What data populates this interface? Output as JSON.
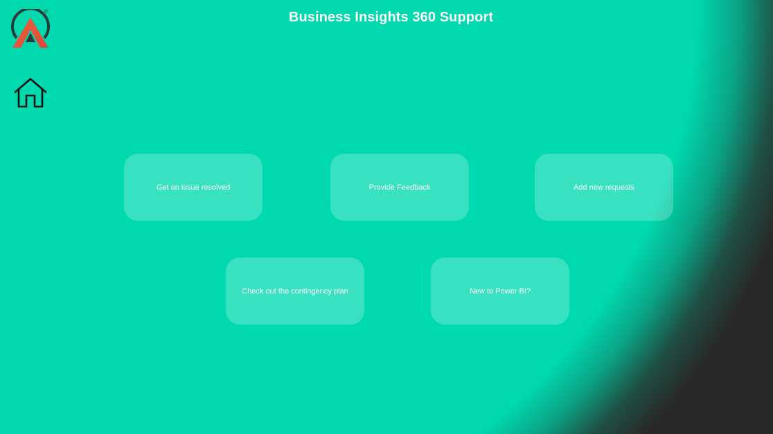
{
  "header": {
    "title": "Business Insights 360 Support",
    "registered_mark": "®"
  },
  "nav": {
    "logo_icon": "brand-logo-icon",
    "home_icon": "home-icon"
  },
  "tiles": [
    {
      "label": "Get an issue resolved"
    },
    {
      "label": "Provide Feedback"
    },
    {
      "label": "Add new requests"
    },
    {
      "label": "Check out the contingency plan"
    },
    {
      "label": "New to Power BI?"
    }
  ],
  "colors": {
    "background": "#00d9ae",
    "corner": "#282828",
    "logo_ring": "#2b3a3a",
    "logo_orange": "#e3553f",
    "text": "#ffffff"
  }
}
